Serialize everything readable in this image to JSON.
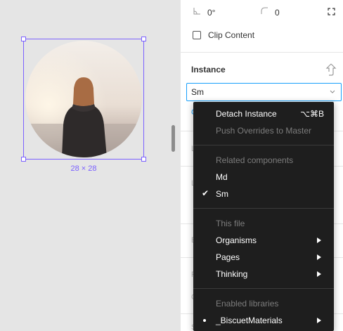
{
  "canvas": {
    "size_label": "28 × 28"
  },
  "panel": {
    "rotation_value": "0°",
    "radius_value": "0",
    "clip_content_label": "Clip Content",
    "instance_title": "Instance",
    "instance_selected": "Sm",
    "ghost_labels": [
      "C",
      "L",
      "L",
      "E",
      "F",
      "C",
      "S"
    ]
  },
  "menu": {
    "detach_label": "Detach Instance",
    "detach_shortcut": "⌥⌘B",
    "push_overrides_label": "Push Overrides to Master",
    "related_header": "Related components",
    "related_items": [
      {
        "label": "Md",
        "checked": false
      },
      {
        "label": "Sm",
        "checked": true
      }
    ],
    "this_file_header": "This file",
    "file_items": [
      {
        "label": "Organisms"
      },
      {
        "label": "Pages"
      },
      {
        "label": "Thinking"
      }
    ],
    "enabled_header": "Enabled libraries",
    "library_items": [
      {
        "label": "_BiscuetMaterials"
      }
    ]
  },
  "colors": {
    "selection": "#7b61ff",
    "focus_blue": "#18a0fb",
    "menu_bg": "#1e1e1e"
  }
}
